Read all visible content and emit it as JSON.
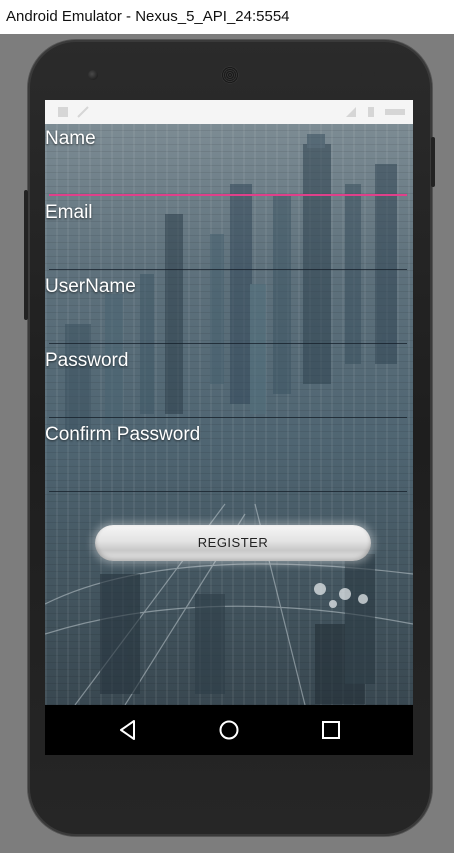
{
  "window": {
    "title": "Android Emulator - Nexus_5_API_24:5554"
  },
  "form": {
    "fields": [
      {
        "label": "Name",
        "value": ""
      },
      {
        "label": "Email",
        "value": ""
      },
      {
        "label": "UserName",
        "value": ""
      },
      {
        "label": "Password",
        "value": ""
      },
      {
        "label": "Confirm Password",
        "value": ""
      }
    ],
    "register_label": "REGISTER"
  },
  "navbar": {
    "icons": [
      "back-icon",
      "home-icon",
      "recents-icon"
    ]
  },
  "colors": {
    "accent": "#e0408a",
    "phone_body": "#222222",
    "status_bar": "#f5f5f5"
  }
}
